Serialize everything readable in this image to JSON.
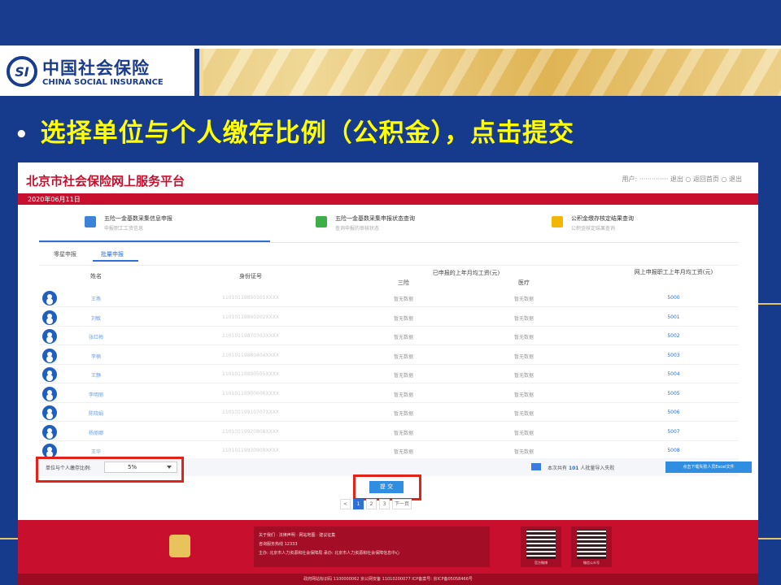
{
  "slide": {
    "logo_mark": "SI",
    "logo_cn": "中国社会保险",
    "logo_en": "CHINA SOCIAL INSURANCE",
    "bullet": "•",
    "headline": "选择单位与个人缴存比例（公积金），点击提交"
  },
  "site": {
    "title": "北京市社会保险网上服务平台",
    "user_bar": "用户: ·············· 退出 ○ 返回首页 ○ 退出",
    "date": "2020年06月11日"
  },
  "steps": [
    {
      "title": "五险一金基数采集信息申报",
      "sub": "申报职工工资信息"
    },
    {
      "title": "五险一金基数采集申报状态查询",
      "sub": "查询申报的审核状态"
    },
    {
      "title": "公积金缴存核定结果查询",
      "sub": "公积金核定结果查询"
    }
  ],
  "tabs": [
    "零星申报",
    "批量申报"
  ],
  "table": {
    "headers": {
      "name": "姓名",
      "id": "身份证号",
      "group": "已申报的上年月均工资(元)",
      "a": "三险",
      "b": "医疗",
      "wage": "网上申报职工上年月均工资(元)"
    },
    "rows": [
      {
        "name": "王燕",
        "id": "11010119850101XXXX",
        "a": "暂无数据",
        "b": "暂无数据",
        "wage": "5000"
      },
      {
        "name": "刘敏",
        "id": "11010119860202XXXX",
        "a": "暂无数据",
        "b": "暂无数据",
        "wage": "5001"
      },
      {
        "name": "张红梅",
        "id": "11010119870303XXXX",
        "a": "暂无数据",
        "b": "暂无数据",
        "wage": "5002"
      },
      {
        "name": "李楠",
        "id": "11010119880404XXXX",
        "a": "暂无数据",
        "b": "暂无数据",
        "wage": "5003"
      },
      {
        "name": "王静",
        "id": "11010119890505XXXX",
        "a": "暂无数据",
        "b": "暂无数据",
        "wage": "5004"
      },
      {
        "name": "李明丽",
        "id": "11010119900606XXXX",
        "a": "暂无数据",
        "b": "暂无数据",
        "wage": "5005"
      },
      {
        "name": "陈晓娟",
        "id": "11010119910707XXXX",
        "a": "暂无数据",
        "b": "暂无数据",
        "wage": "5006"
      },
      {
        "name": "杨丽娜",
        "id": "11010119920808XXXX",
        "a": "暂无数据",
        "b": "暂无数据",
        "wage": "5007"
      },
      {
        "name": "王华",
        "id": "11010119930909XXXX",
        "a": "暂无数据",
        "b": "暂无数据",
        "wage": "5008"
      }
    ]
  },
  "footer_bar": {
    "ratio_label": "单位与个人缴存比例:",
    "ratio_value": "5%",
    "total_prefix": "本次共有",
    "total_count": "101",
    "total_suffix": "人批量导入失败",
    "export_label": "点击下载失败人员Excel文件"
  },
  "submit_label": "提 交",
  "pager": [
    "<",
    "1",
    "2",
    "3",
    "下一页"
  ],
  "footer": {
    "links": "关于我们 · 法律声明 · 网站地图 · 建议征集",
    "line2": "咨询服务热线 12333",
    "line3": "主办: 北京市人力资源和社会保障局    承办: 北京市人力资源和社会保障信息中心",
    "qr1": "官方微博",
    "qr2": "微信公众号",
    "copyright": "政府网站标识码 1100000062    京公网安备 11010200077    ICP备案号: 京ICP备05058466号"
  }
}
